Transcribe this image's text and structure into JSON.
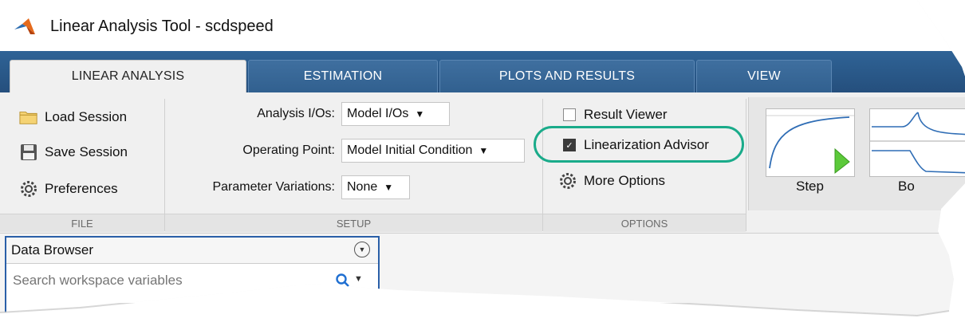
{
  "window": {
    "title": "Linear Analysis Tool - scdspeed"
  },
  "tabs": [
    {
      "label": "LINEAR ANALYSIS",
      "active": true
    },
    {
      "label": "ESTIMATION",
      "active": false
    },
    {
      "label": "PLOTS AND RESULTS",
      "active": false
    },
    {
      "label": "VIEW",
      "active": false
    }
  ],
  "file_section": {
    "label": "FILE",
    "load_session": "Load Session",
    "save_session": "Save Session",
    "preferences": "Preferences"
  },
  "setup_section": {
    "label": "SETUP",
    "analysis_ios_label": "Analysis I/Os:",
    "analysis_ios_value": "Model I/Os",
    "operating_point_label": "Operating Point:",
    "operating_point_value": "Model Initial Condition",
    "parameter_variations_label": "Parameter Variations:",
    "parameter_variations_value": "None"
  },
  "options_section": {
    "label": "OPTIONS",
    "result_viewer": {
      "label": "Result Viewer",
      "checked": false
    },
    "linearization_advisor": {
      "label": "Linearization Advisor",
      "checked": true
    },
    "more_options": "More Options"
  },
  "plots": [
    {
      "label": "Step",
      "icon": "step-plot-icon"
    },
    {
      "label": "Bo",
      "icon": "bode-plot-icon"
    }
  ],
  "data_browser": {
    "title": "Data Browser",
    "search_placeholder": "Search workspace variables"
  },
  "colors": {
    "tabstrip": "#2c5d8f",
    "highlight": "#1aab8a",
    "browser_border": "#2a5fa8"
  }
}
